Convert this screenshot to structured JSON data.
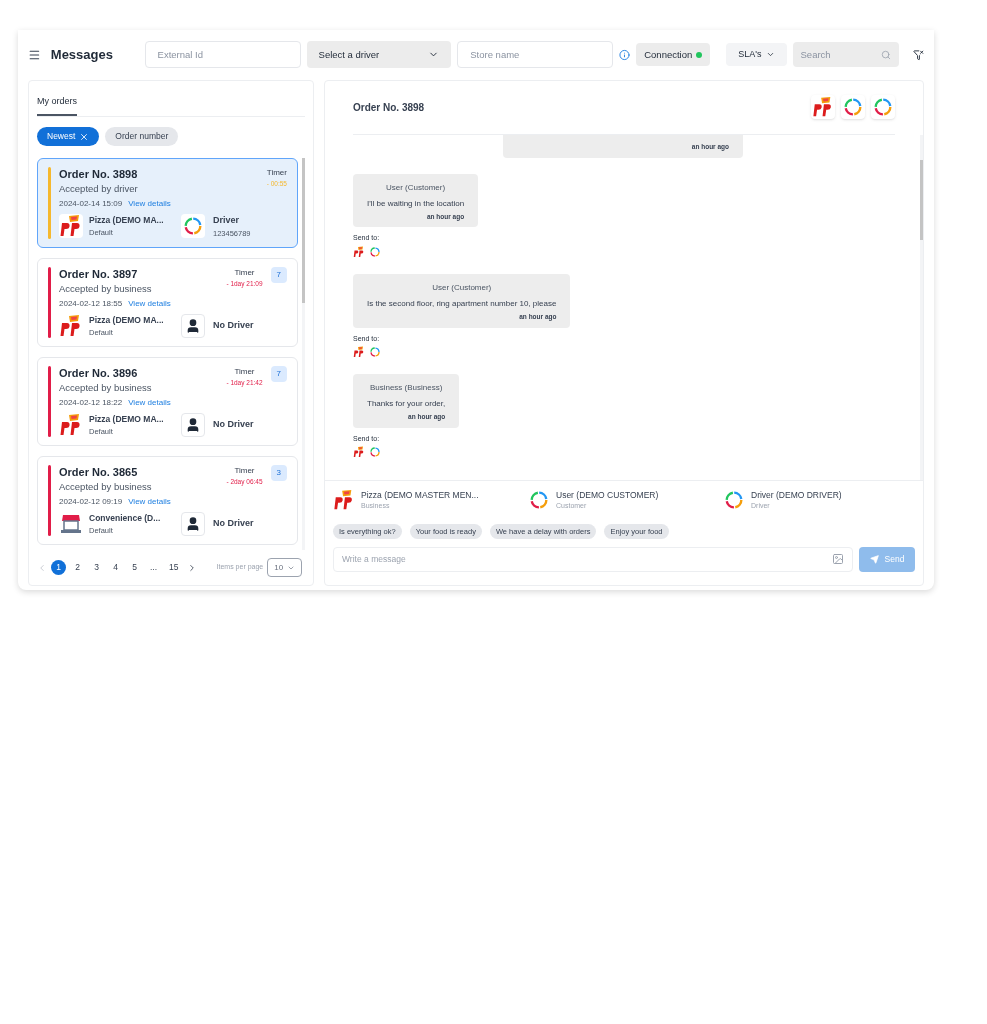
{
  "header": {
    "title": "Messages",
    "filters": [
      {
        "kind": "input",
        "placeholder": "External Id"
      },
      {
        "kind": "select",
        "value": "Select a driver"
      },
      {
        "kind": "input",
        "placeholder": "Store name"
      }
    ],
    "connection": {
      "label": "Connection",
      "online": true
    },
    "sla": "SLA's",
    "search": {
      "placeholder": "Search"
    }
  },
  "orders_panel": {
    "tab": "My orders",
    "sort_chips": [
      {
        "label": "Newest",
        "selected": true
      },
      {
        "label": "Order number",
        "selected": false
      }
    ],
    "orders": [
      {
        "title": "Order No. 3898",
        "status": "Accepted by driver",
        "date": "2024-02-14 15:09",
        "link": "View details",
        "timer_label": "Timer",
        "timer": "- 00:55",
        "color": "#f5b82e",
        "selected": true,
        "business": {
          "kind": "pizza",
          "name": "Pizza (DEMO MA...",
          "sub": "Default"
        },
        "driver": {
          "kind": "assigned",
          "name": "Driver",
          "sub": "123456789"
        }
      },
      {
        "title": "Order No. 3897",
        "status": "Accepted by business",
        "date": "2024-02-12 18:55",
        "link": "View details",
        "timer_label": "Timer",
        "timer": "- 1day 21:09",
        "color": "#e11d48",
        "selected": false,
        "badge": "7",
        "business": {
          "kind": "pizza",
          "name": "Pizza (DEMO MA...",
          "sub": "Default"
        },
        "driver": {
          "kind": "none",
          "name": "No Driver"
        }
      },
      {
        "title": "Order No. 3896",
        "status": "Accepted by business",
        "date": "2024-02-12 18:22",
        "link": "View details",
        "timer_label": "Timer",
        "timer": "- 1day 21:42",
        "color": "#e11d48",
        "selected": false,
        "badge": "7",
        "business": {
          "kind": "pizza",
          "name": "Pizza (DEMO MA...",
          "sub": "Default"
        },
        "driver": {
          "kind": "none",
          "name": "No Driver"
        }
      },
      {
        "title": "Order No. 3865",
        "status": "Accepted by business",
        "date": "2024-02-12 09:19",
        "link": "View details",
        "timer_label": "Timer",
        "timer": "- 2day 06:45",
        "color": "#e11d48",
        "selected": false,
        "badge": "3",
        "business": {
          "kind": "store",
          "name": "Convenience (D...",
          "sub": "Default"
        },
        "driver": {
          "kind": "none",
          "name": "No Driver"
        }
      }
    ],
    "pagination": {
      "pages": [
        {
          "label": "1",
          "selected": true
        },
        {
          "label": "2",
          "selected": false
        },
        {
          "label": "3",
          "selected": false
        },
        {
          "label": "4",
          "selected": false
        },
        {
          "label": "5",
          "selected": false
        },
        {
          "label": "...",
          "selected": false
        },
        {
          "label": "15",
          "selected": false
        }
      ],
      "per_page_label": "Items per page",
      "per_page": "10"
    }
  },
  "chat": {
    "title": "Order No. 3898",
    "messages": [
      {
        "kind": "partial",
        "time": "an hour ago"
      },
      {
        "kind": "message",
        "author": "User (Customer)",
        "text": "I'll be waiting in the location",
        "time": "an hour ago",
        "send_to": "Send to:"
      },
      {
        "kind": "message",
        "author": "User (Customer)",
        "text": "Is the second floor, ring apartment number 10, please",
        "time": "an hour ago",
        "send_to": "Send to:"
      },
      {
        "kind": "message",
        "author": "Business (Business)",
        "text": "Thanks for your order,",
        "time": "an hour ago",
        "send_to": "Send to:"
      }
    ],
    "participants": [
      {
        "kind": "pizza",
        "name": "Pizza (DEMO MASTER MEN...",
        "role": "Business"
      },
      {
        "kind": "ring",
        "name": "User (DEMO CUSTOMER)",
        "role": "Customer"
      },
      {
        "kind": "ring",
        "name": "Driver (DEMO DRIVER)",
        "role": "Driver"
      }
    ],
    "quick_replies": [
      "Is everything ok?",
      "Your food is ready",
      "We have a delay with orders",
      "Enjoy your food"
    ],
    "input": {
      "placeholder": "Write a message"
    },
    "send": {
      "label": "Send",
      "disabled": true
    }
  }
}
